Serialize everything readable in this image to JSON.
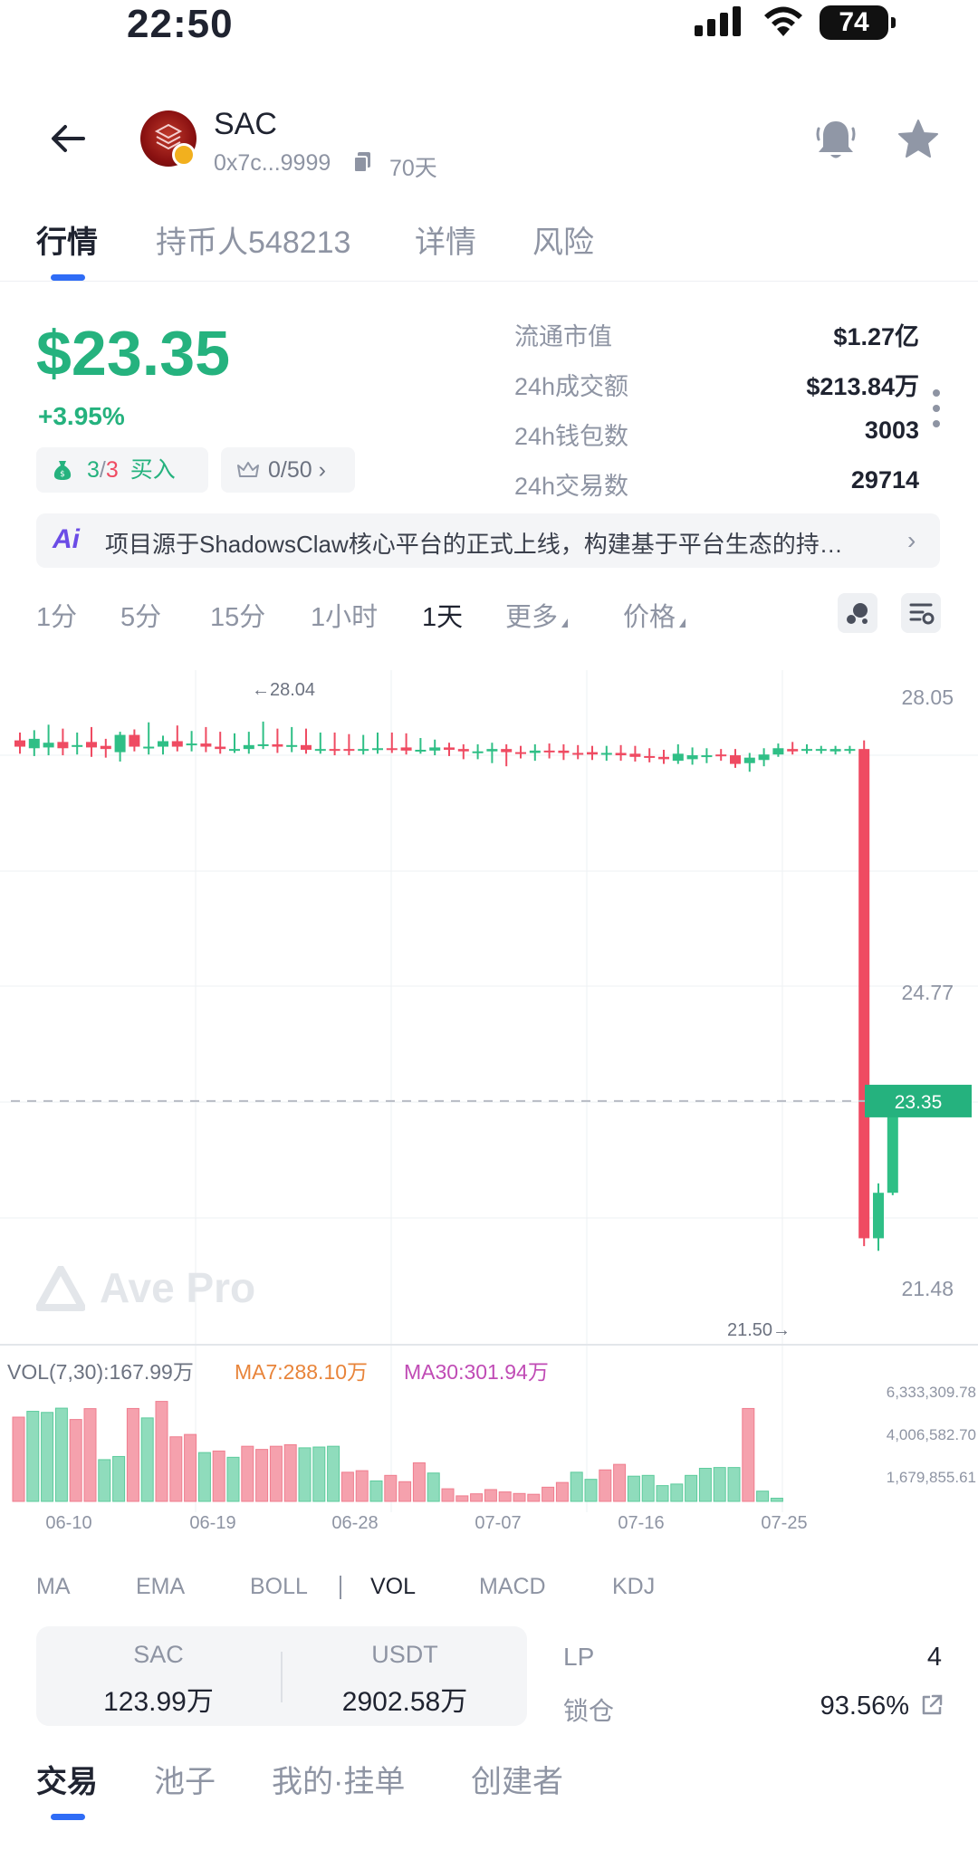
{
  "status_bar": {
    "time": "22:50",
    "battery": "74"
  },
  "header": {
    "token_name": "SAC",
    "address": "0x7c...9999",
    "age": "70天"
  },
  "tabs": [
    {
      "label": "行情",
      "active": true
    },
    {
      "label": "持币人548213",
      "active": false
    },
    {
      "label": "详情",
      "active": false
    },
    {
      "label": "风险",
      "active": false
    }
  ],
  "price": {
    "value": "$23.35",
    "change": "+3.95%",
    "buy_chip": {
      "count": "3",
      "slash": "/",
      "total": "3",
      "label": "买入"
    },
    "top_chip": "0/50"
  },
  "stats": [
    {
      "label": "流通市值",
      "value": "$1.27亿"
    },
    {
      "label": "24h成交额",
      "value": "$213.84万"
    },
    {
      "label": "24h钱包数",
      "value": "3003"
    },
    {
      "label": "24h交易数",
      "value": "29714"
    }
  ],
  "ai_banner": {
    "icon": "Ai",
    "text": "项目源于ShadowsClaw核心平台的正式上线，构建基于平台生态的持…"
  },
  "timeframes": [
    {
      "label": "1分",
      "active": false
    },
    {
      "label": "5分",
      "active": false
    },
    {
      "label": "15分",
      "active": false
    },
    {
      "label": "1小时",
      "active": false
    },
    {
      "label": "1天",
      "active": true
    },
    {
      "label": "更多",
      "active": false,
      "dropdown": true
    },
    {
      "label": "价格",
      "active": false,
      "dropdown": true
    }
  ],
  "chart_data": {
    "type": "candlestick",
    "price_axis_labels": [
      "28.05",
      "24.77",
      "21.48"
    ],
    "current_price_label": "23.35",
    "current_price": 23.35,
    "high_marker": "←28.04",
    "low_marker": "21.50→",
    "watermark": "Ave Pro",
    "x_labels": [
      "06-10",
      "06-19",
      "06-28",
      "07-07",
      "07-16",
      "07-25"
    ],
    "ylim": [
      20.3,
      28.5
    ],
    "up_color": "#2fbf86",
    "down_color": "#ef4b62",
    "candles": [
      {
        "o": 27.95,
        "c": 27.87,
        "h": 28.05,
        "l": 27.78
      },
      {
        "o": 27.85,
        "c": 27.97,
        "h": 28.08,
        "l": 27.75
      },
      {
        "o": 27.86,
        "c": 27.92,
        "h": 28.15,
        "l": 27.76
      },
      {
        "o": 27.93,
        "c": 27.85,
        "h": 28.1,
        "l": 27.76
      },
      {
        "o": 27.88,
        "c": 27.89,
        "h": 28.05,
        "l": 27.77
      },
      {
        "o": 27.93,
        "c": 27.86,
        "h": 28.12,
        "l": 27.74
      },
      {
        "o": 27.88,
        "c": 27.84,
        "h": 27.97,
        "l": 27.73
      },
      {
        "o": 27.8,
        "c": 28.02,
        "h": 28.06,
        "l": 27.68
      },
      {
        "o": 28.02,
        "c": 27.87,
        "h": 28.09,
        "l": 27.81
      },
      {
        "o": 27.87,
        "c": 27.87,
        "h": 28.18,
        "l": 27.77
      },
      {
        "o": 27.87,
        "c": 27.94,
        "h": 28.01,
        "l": 27.77
      },
      {
        "o": 27.94,
        "c": 27.87,
        "h": 28.14,
        "l": 27.81
      },
      {
        "o": 27.89,
        "c": 27.91,
        "h": 28.07,
        "l": 27.81
      },
      {
        "o": 27.91,
        "c": 27.87,
        "h": 28.12,
        "l": 27.8
      },
      {
        "o": 27.87,
        "c": 27.84,
        "h": 28.06,
        "l": 27.78
      },
      {
        "o": 27.84,
        "c": 27.84,
        "h": 28.04,
        "l": 27.79
      },
      {
        "o": 27.84,
        "c": 27.89,
        "h": 28.06,
        "l": 27.78
      },
      {
        "o": 27.89,
        "c": 27.9,
        "h": 28.19,
        "l": 27.84
      },
      {
        "o": 27.9,
        "c": 27.87,
        "h": 28.1,
        "l": 27.79
      },
      {
        "o": 27.87,
        "c": 27.89,
        "h": 28.12,
        "l": 27.8
      },
      {
        "o": 27.89,
        "c": 27.83,
        "h": 28.1,
        "l": 27.78
      },
      {
        "o": 27.83,
        "c": 27.84,
        "h": 28.05,
        "l": 27.78
      },
      {
        "o": 27.84,
        "c": 27.82,
        "h": 28.05,
        "l": 27.76
      },
      {
        "o": 27.84,
        "c": 27.82,
        "h": 28.03,
        "l": 27.76
      },
      {
        "o": 27.82,
        "c": 27.84,
        "h": 28.02,
        "l": 27.77
      },
      {
        "o": 27.84,
        "c": 27.85,
        "h": 28.05,
        "l": 27.78
      },
      {
        "o": 27.85,
        "c": 27.84,
        "h": 28.05,
        "l": 27.79
      },
      {
        "o": 27.86,
        "c": 27.82,
        "h": 28.04,
        "l": 27.77
      },
      {
        "o": 27.83,
        "c": 27.83,
        "h": 27.98,
        "l": 27.78
      },
      {
        "o": 27.82,
        "c": 27.86,
        "h": 27.96,
        "l": 27.76
      },
      {
        "o": 27.86,
        "c": 27.83,
        "h": 27.92,
        "l": 27.75
      },
      {
        "o": 27.84,
        "c": 27.81,
        "h": 27.9,
        "l": 27.71
      },
      {
        "o": 27.81,
        "c": 27.81,
        "h": 27.9,
        "l": 27.71
      },
      {
        "o": 27.81,
        "c": 27.84,
        "h": 27.92,
        "l": 27.66
      },
      {
        "o": 27.84,
        "c": 27.8,
        "h": 27.9,
        "l": 27.62
      },
      {
        "o": 27.8,
        "c": 27.78,
        "h": 27.88,
        "l": 27.72
      },
      {
        "o": 27.79,
        "c": 27.82,
        "h": 27.9,
        "l": 27.69
      },
      {
        "o": 27.82,
        "c": 27.81,
        "h": 27.91,
        "l": 27.72
      },
      {
        "o": 27.82,
        "c": 27.79,
        "h": 27.9,
        "l": 27.7
      },
      {
        "o": 27.79,
        "c": 27.78,
        "h": 27.89,
        "l": 27.71
      },
      {
        "o": 27.8,
        "c": 27.77,
        "h": 27.88,
        "l": 27.7
      },
      {
        "o": 27.77,
        "c": 27.79,
        "h": 27.88,
        "l": 27.69
      },
      {
        "o": 27.79,
        "c": 27.76,
        "h": 27.89,
        "l": 27.69
      },
      {
        "o": 27.78,
        "c": 27.74,
        "h": 27.88,
        "l": 27.68
      },
      {
        "o": 27.75,
        "c": 27.73,
        "h": 27.85,
        "l": 27.67
      },
      {
        "o": 27.74,
        "c": 27.71,
        "h": 27.83,
        "l": 27.65
      },
      {
        "o": 27.69,
        "c": 27.78,
        "h": 27.9,
        "l": 27.65
      },
      {
        "o": 27.71,
        "c": 27.76,
        "h": 27.86,
        "l": 27.64
      },
      {
        "o": 27.76,
        "c": 27.76,
        "h": 27.85,
        "l": 27.66
      },
      {
        "o": 27.77,
        "c": 27.75,
        "h": 27.84,
        "l": 27.69
      },
      {
        "o": 27.76,
        "c": 27.65,
        "h": 27.84,
        "l": 27.6
      },
      {
        "o": 27.66,
        "c": 27.73,
        "h": 27.79,
        "l": 27.55
      },
      {
        "o": 27.7,
        "c": 27.77,
        "h": 27.85,
        "l": 27.62
      },
      {
        "o": 27.77,
        "c": 27.85,
        "h": 27.91,
        "l": 27.74
      },
      {
        "o": 27.84,
        "c": 27.81,
        "h": 27.93,
        "l": 27.77
      },
      {
        "o": 27.84,
        "c": 27.84,
        "h": 27.9,
        "l": 27.78
      },
      {
        "o": 27.82,
        "c": 27.84,
        "h": 27.88,
        "l": 27.78
      },
      {
        "o": 27.81,
        "c": 27.84,
        "h": 27.88,
        "l": 27.77
      },
      {
        "o": 27.83,
        "c": 27.84,
        "h": 27.88,
        "l": 27.78
      },
      {
        "o": 27.84,
        "c": 21.6,
        "h": 27.95,
        "l": 21.5
      },
      {
        "o": 21.6,
        "c": 22.18,
        "h": 22.3,
        "l": 21.44
      },
      {
        "o": 22.18,
        "c": 23.35,
        "h": 23.45,
        "l": 22.15
      }
    ]
  },
  "volume": {
    "title": "VOL(7,30):167.99万",
    "ma7": "MA7:288.10万",
    "ma30": "MA30:301.94万",
    "axis_labels": [
      "6,333,309.78",
      "4,006,582.70",
      "1,679,855.61"
    ],
    "ylim": [
      0,
      6500000
    ],
    "bars": [
      {
        "v": 5350000,
        "up": false
      },
      {
        "v": 5720000,
        "up": true
      },
      {
        "v": 5650000,
        "up": true
      },
      {
        "v": 5920000,
        "up": true
      },
      {
        "v": 5200000,
        "up": false
      },
      {
        "v": 5890000,
        "up": false
      },
      {
        "v": 2650000,
        "up": true
      },
      {
        "v": 2850000,
        "up": true
      },
      {
        "v": 5900000,
        "up": false
      },
      {
        "v": 5300000,
        "up": true
      },
      {
        "v": 6350000,
        "up": false
      },
      {
        "v": 4100000,
        "up": false
      },
      {
        "v": 4250000,
        "up": false
      },
      {
        "v": 3100000,
        "up": true
      },
      {
        "v": 3200000,
        "up": false
      },
      {
        "v": 2800000,
        "up": true
      },
      {
        "v": 3500000,
        "up": false
      },
      {
        "v": 3300000,
        "up": false
      },
      {
        "v": 3500000,
        "up": false
      },
      {
        "v": 3600000,
        "up": false
      },
      {
        "v": 3400000,
        "up": true
      },
      {
        "v": 3450000,
        "up": true
      },
      {
        "v": 3500000,
        "up": true
      },
      {
        "v": 1850000,
        "up": false
      },
      {
        "v": 1950000,
        "up": false
      },
      {
        "v": 1300000,
        "up": true
      },
      {
        "v": 1650000,
        "up": false
      },
      {
        "v": 1250000,
        "up": false
      },
      {
        "v": 2450000,
        "up": false
      },
      {
        "v": 1800000,
        "up": true
      },
      {
        "v": 800000,
        "up": false
      },
      {
        "v": 350000,
        "up": false
      },
      {
        "v": 480000,
        "up": false
      },
      {
        "v": 750000,
        "up": false
      },
      {
        "v": 600000,
        "up": false
      },
      {
        "v": 500000,
        "up": false
      },
      {
        "v": 450000,
        "up": false
      },
      {
        "v": 900000,
        "up": false
      },
      {
        "v": 1200000,
        "up": false
      },
      {
        "v": 1850000,
        "up": true
      },
      {
        "v": 1400000,
        "up": true
      },
      {
        "v": 2000000,
        "up": false
      },
      {
        "v": 2350000,
        "up": false
      },
      {
        "v": 1600000,
        "up": true
      },
      {
        "v": 1650000,
        "up": true
      },
      {
        "v": 1000000,
        "up": true
      },
      {
        "v": 1100000,
        "up": true
      },
      {
        "v": 1650000,
        "up": true
      },
      {
        "v": 2100000,
        "up": true
      },
      {
        "v": 2150000,
        "up": true
      },
      {
        "v": 2150000,
        "up": true
      },
      {
        "v": 5900000,
        "up": false
      },
      {
        "v": 650000,
        "up": true
      },
      {
        "v": 200000,
        "up": true
      }
    ]
  },
  "indicators": [
    {
      "label": "MA",
      "active": false
    },
    {
      "label": "EMA",
      "active": false
    },
    {
      "label": "BOLL",
      "active": false
    },
    {
      "label": "VOL",
      "active": true
    },
    {
      "label": "MACD",
      "active": false
    },
    {
      "label": "KDJ",
      "active": false
    }
  ],
  "pool": {
    "token_label": "SAC",
    "token_value": "123.99万",
    "quote_label": "USDT",
    "quote_value": "2902.58万"
  },
  "lp": {
    "label": "LP",
    "value": "4"
  },
  "lock": {
    "label": "锁仓",
    "value": "93.56%"
  },
  "bottom_tabs": [
    {
      "label": "交易",
      "active": true
    },
    {
      "label": "池子",
      "active": false
    },
    {
      "label": "我的·挂单",
      "active": false
    },
    {
      "label": "创建者",
      "active": false
    }
  ],
  "colors": {
    "up": "#25b27e",
    "down": "#ef4b62",
    "accent": "#2f6cf6",
    "ma7": "#e8843a",
    "ma30": "#c04bb5"
  }
}
